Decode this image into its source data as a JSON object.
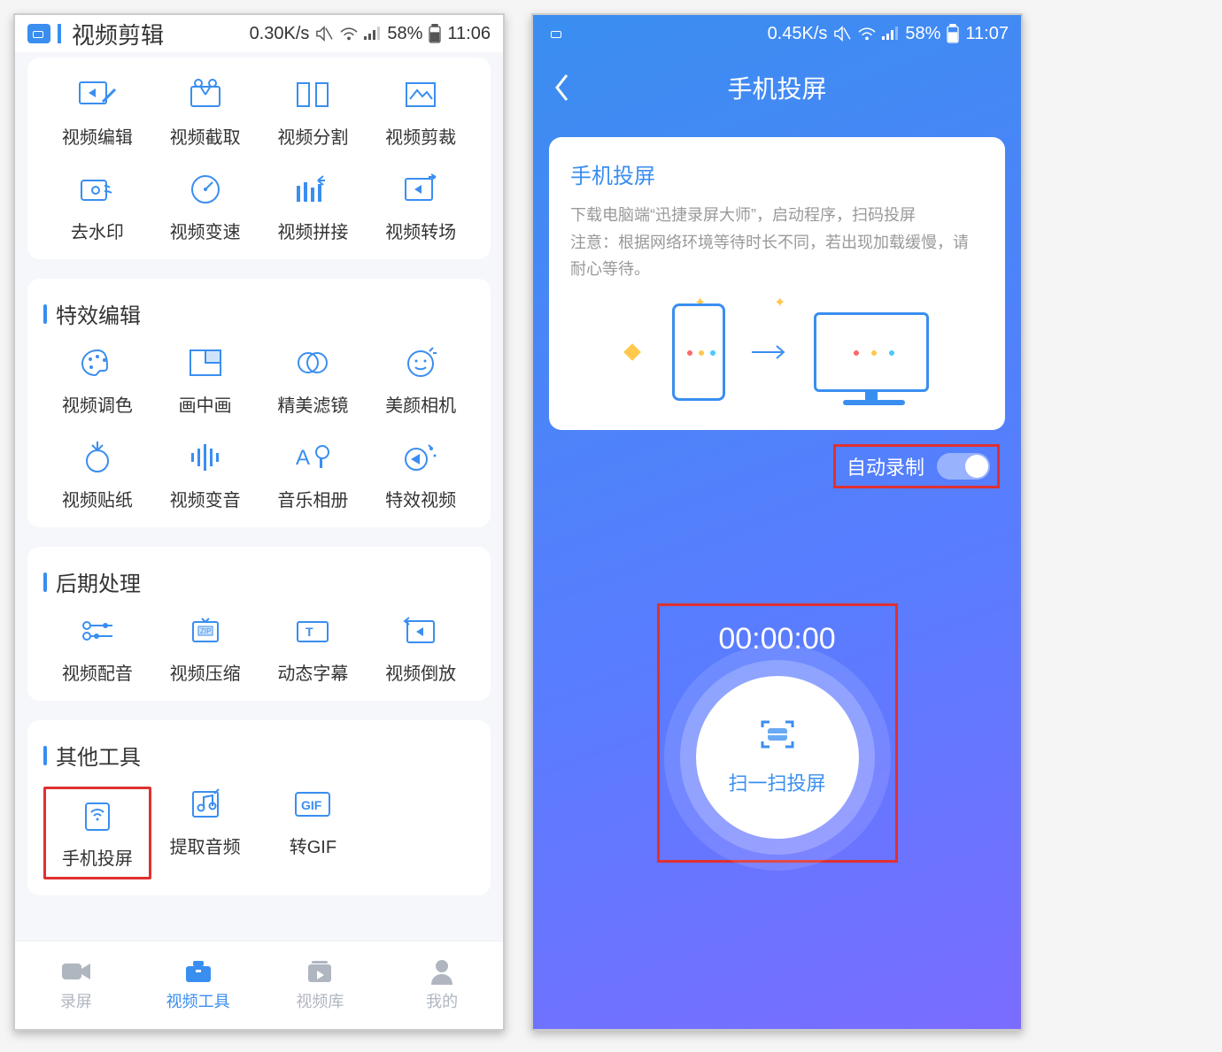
{
  "left": {
    "status": {
      "speed": "0.30K/s",
      "battery": "58%",
      "time": "11:06"
    },
    "header_title": "视频剪辑",
    "sections": [
      {
        "title": "视频剪辑",
        "tools": [
          {
            "label": "视频编辑",
            "icon": "video-edit"
          },
          {
            "label": "视频截取",
            "icon": "video-cut"
          },
          {
            "label": "视频分割",
            "icon": "video-split"
          },
          {
            "label": "视频剪裁",
            "icon": "video-crop"
          },
          {
            "label": "去水印",
            "icon": "watermark"
          },
          {
            "label": "视频变速",
            "icon": "speed"
          },
          {
            "label": "视频拼接",
            "icon": "merge"
          },
          {
            "label": "视频转场",
            "icon": "transition"
          }
        ]
      },
      {
        "title": "特效编辑",
        "tools": [
          {
            "label": "视频调色",
            "icon": "palette"
          },
          {
            "label": "画中画",
            "icon": "pip"
          },
          {
            "label": "精美滤镜",
            "icon": "filter"
          },
          {
            "label": "美颜相机",
            "icon": "beauty"
          },
          {
            "label": "视频贴纸",
            "icon": "sticker"
          },
          {
            "label": "视频变音",
            "icon": "voice"
          },
          {
            "label": "音乐相册",
            "icon": "album"
          },
          {
            "label": "特效视频",
            "icon": "fx"
          }
        ]
      },
      {
        "title": "后期处理",
        "tools": [
          {
            "label": "视频配音",
            "icon": "dub"
          },
          {
            "label": "视频压缩",
            "icon": "zip"
          },
          {
            "label": "动态字幕",
            "icon": "subtitle"
          },
          {
            "label": "视频倒放",
            "icon": "reverse"
          }
        ]
      },
      {
        "title": "其他工具",
        "tools": [
          {
            "label": "手机投屏",
            "icon": "cast",
            "highlight": true
          },
          {
            "label": "提取音频",
            "icon": "extract"
          },
          {
            "label": "转GIF",
            "icon": "gif"
          }
        ]
      }
    ],
    "nav": [
      {
        "label": "录屏",
        "icon": "record",
        "active": false
      },
      {
        "label": "视频工具",
        "icon": "toolbox",
        "active": true
      },
      {
        "label": "视频库",
        "icon": "library",
        "active": false
      },
      {
        "label": "我的",
        "icon": "me",
        "active": false
      }
    ]
  },
  "right": {
    "status": {
      "speed": "0.45K/s",
      "battery": "58%",
      "time": "11:07"
    },
    "title": "手机投屏",
    "card": {
      "title": "手机投屏",
      "desc1": "下载电脑端“迅捷录屏大师”，启动程序，扫码投屏",
      "desc2": "注意：根据网络环境等待时长不同，若出现加载缓慢，请耐心等待。"
    },
    "auto_record_label": "自动录制",
    "timer": "00:00:00",
    "scan_label": "扫一扫投屏"
  }
}
